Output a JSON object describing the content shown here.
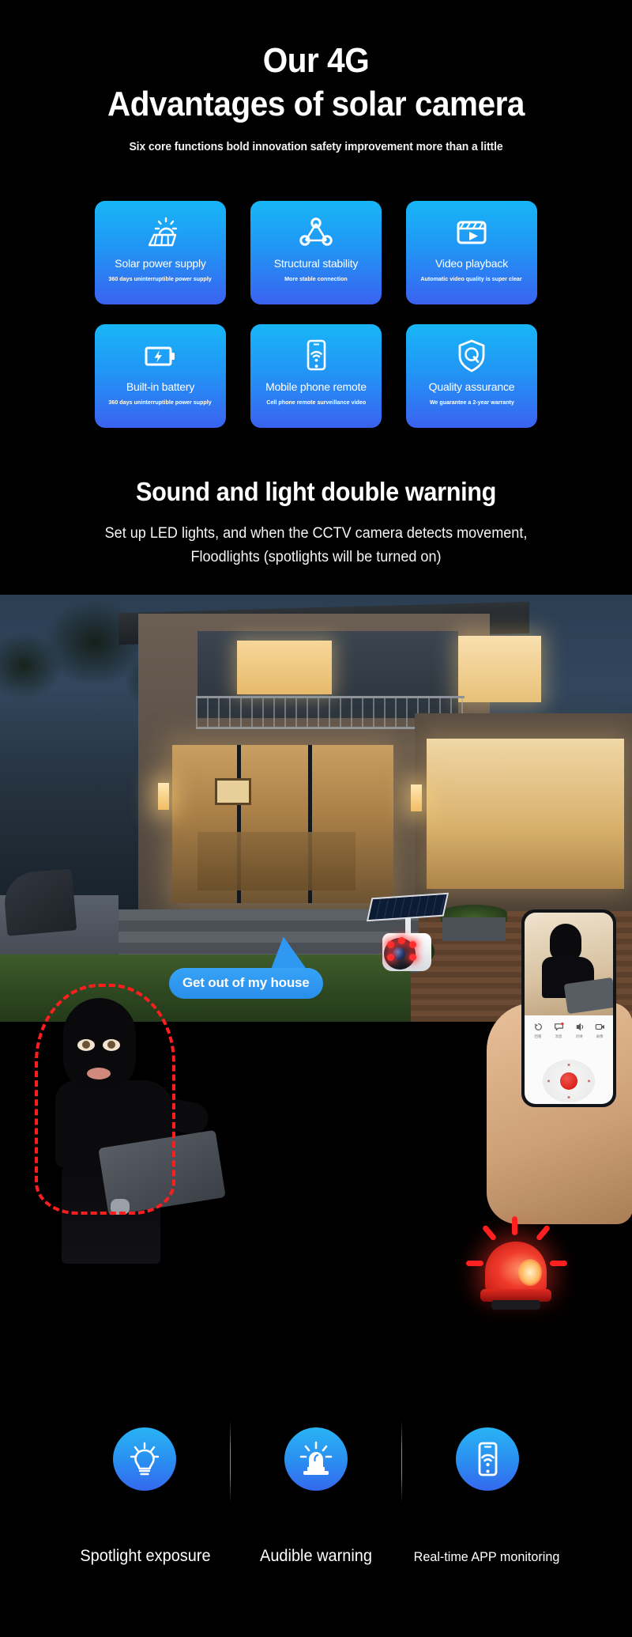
{
  "hero": {
    "title_line1": "Our 4G",
    "title_line2": "Advantages of solar camera",
    "subtitle": "Six core functions bold innovation safety improvement more than a little"
  },
  "features": {
    "cards": [
      {
        "icon": "solar-panel-icon",
        "title": "Solar power supply",
        "desc": "360 days uninterruptible power supply"
      },
      {
        "icon": "triangle-nodes-icon",
        "title": "Structural stability",
        "desc": "More stable connection"
      },
      {
        "icon": "video-clapper-play-icon",
        "title": "Video playback",
        "desc": "Automatic video quality is super clear"
      },
      {
        "icon": "battery-bolt-icon",
        "title": "Built-in battery",
        "desc": "360 days uninterruptible power supply"
      },
      {
        "icon": "phone-wifi-icon",
        "title": "Mobile phone remote",
        "desc": "Cell phone remote surveillance video"
      },
      {
        "icon": "shield-q-icon",
        "title": "Quality assurance",
        "desc": "We guarantee a 2-year warranty"
      }
    ]
  },
  "warning": {
    "title": "Sound and light double warning",
    "subtitle_line1": "Set up LED lights, and when the CCTV camera detects movement,",
    "subtitle_line2": "Floodlights (spotlights will be turned on)"
  },
  "scene": {
    "speech_bubble": "Get out of my house",
    "phone_app": {
      "controls": [
        {
          "icon": "playback-rewind-icon",
          "label": "回看"
        },
        {
          "icon": "message-alert-icon",
          "label": "消息"
        },
        {
          "icon": "intercom-speak-icon",
          "label": "对讲"
        },
        {
          "icon": "video-record-icon",
          "label": "录像"
        }
      ],
      "record_button": "record-button"
    }
  },
  "bottom": {
    "items": [
      {
        "icon": "lightbulb-rays-icon",
        "label": "Spotlight exposure"
      },
      {
        "icon": "siren-alarm-icon",
        "label": "Audible warning"
      },
      {
        "icon": "phone-wifi-icon",
        "label": "Real-time APP monitoring"
      }
    ]
  },
  "colors": {
    "background": "#000000",
    "card_gradient_top": "#18b6f7",
    "card_gradient_bottom": "#3a62f0",
    "accent_blue": "#2a8eeb",
    "alert_red": "#ff1d1d",
    "text_white": "#ffffff"
  }
}
